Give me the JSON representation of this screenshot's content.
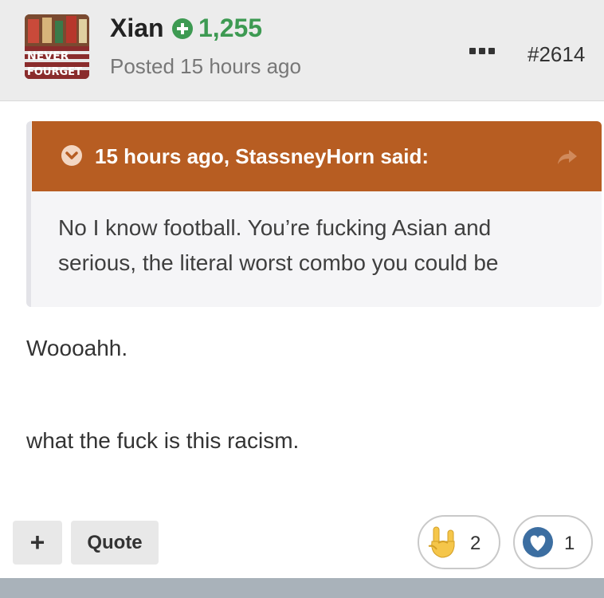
{
  "post": {
    "author": "Xian",
    "reputation": "1,255",
    "posted": "Posted 15 hours ago",
    "post_number": "#2614",
    "avatar_text": [
      "NEVER",
      "FOURGET"
    ],
    "quote": {
      "citation": "15 hours ago, StassneyHorn said:",
      "lines": [
        "No I know football. You’re fucking Asian and",
        "serious, the literal worst combo you could be"
      ]
    },
    "content": [
      "Woooahh.",
      "what the fuck is this racism."
    ]
  },
  "actions": {
    "plus_label": "+",
    "quote_label": "Quote"
  },
  "reactions": [
    {
      "icon": "rock-on-hand-icon",
      "count": "2"
    },
    {
      "icon": "heart-icon",
      "count": "1"
    }
  ],
  "colors": {
    "quote_header": "#b75d22",
    "reputation_green": "#3d9a52",
    "heart_blue": "#3c6ea1"
  }
}
